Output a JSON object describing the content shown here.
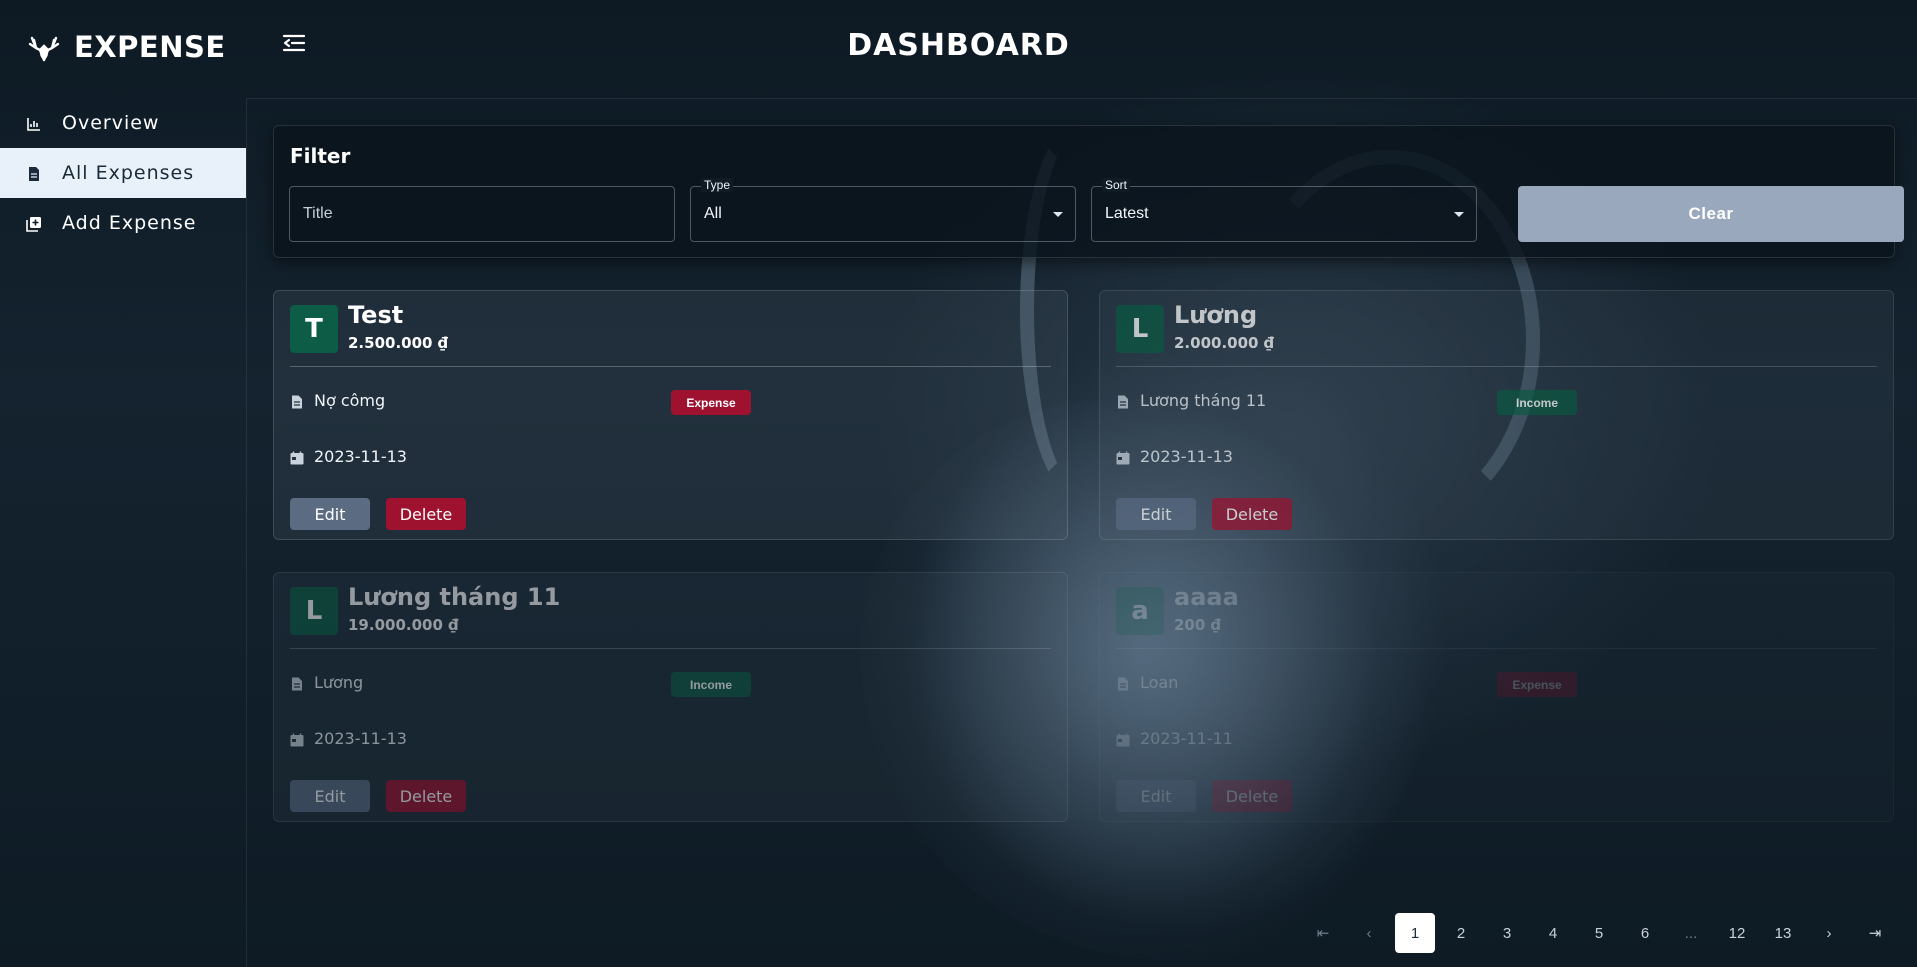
{
  "app": {
    "brand": "EXPENSE",
    "page_title": "DASHBOARD"
  },
  "sidebar": {
    "items": [
      {
        "label": "Overview",
        "icon": "bar-chart-icon",
        "active": false
      },
      {
        "label": "All Expenses",
        "icon": "document-icon",
        "active": true
      },
      {
        "label": "Add Expense",
        "icon": "add-square-icon",
        "active": false
      }
    ]
  },
  "filter": {
    "title": "Filter",
    "title_field": {
      "placeholder": "Title"
    },
    "type_field": {
      "label": "Type",
      "value": "All"
    },
    "sort_field": {
      "label": "Sort",
      "value": "Latest"
    },
    "clear_label": "Clear"
  },
  "cards": [
    {
      "initial": "T",
      "title": "Test",
      "amount": "2.500.000 ₫",
      "category": "Nợ cômg",
      "badge": "Expense",
      "date": "2023-11-13",
      "edit": "Edit",
      "delete": "Delete"
    },
    {
      "initial": "L",
      "title": "Lương",
      "amount": "2.000.000 ₫",
      "category": "Lương tháng 11",
      "badge": "Income",
      "date": "2023-11-13",
      "edit": "Edit",
      "delete": "Delete"
    },
    {
      "initial": "L",
      "title": "Lương tháng 11",
      "amount": "19.000.000 ₫",
      "category": "Lương",
      "badge": "Income",
      "date": "2023-11-13",
      "edit": "Edit",
      "delete": "Delete"
    },
    {
      "initial": "a",
      "title": "aaaa",
      "amount": "200 ₫",
      "category": "Loan",
      "badge": "Expense",
      "date": "2023-11-11",
      "edit": "Edit",
      "delete": "Delete"
    }
  ],
  "pagination": {
    "first": "⇤",
    "prev": "‹",
    "next": "›",
    "last": "⇥",
    "pages": [
      "1",
      "2",
      "3",
      "4",
      "5",
      "6",
      "...",
      "12",
      "13"
    ],
    "current": "1"
  },
  "colors": {
    "expense": "#9e1230",
    "income": "#0e5a44",
    "avatar": "#0d5c45",
    "clear_button": "#9aa8bd",
    "edit_button": "#5a6b82"
  }
}
